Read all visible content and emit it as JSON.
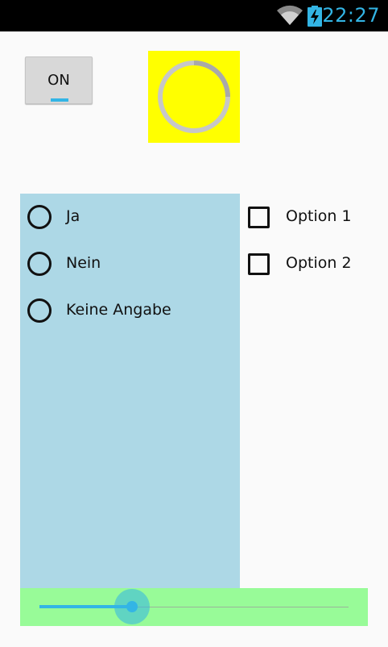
{
  "status_bar": {
    "time": "22:27",
    "wifi_icon": "wifi-icon",
    "battery_icon": "battery-charging-icon",
    "accent_color": "#33b5e5"
  },
  "toggle": {
    "label": "ON",
    "state": "on"
  },
  "spinner": {
    "icon": "progress-spinner-icon",
    "background": "#ffff00"
  },
  "radio_group": {
    "background": "#add8e6",
    "options": [
      {
        "label": "Ja",
        "checked": false
      },
      {
        "label": "Nein",
        "checked": false
      },
      {
        "label": "Keine Angabe",
        "checked": false
      }
    ]
  },
  "checkboxes": [
    {
      "label": "Option 1",
      "checked": false
    },
    {
      "label": "Option 2",
      "checked": false
    }
  ],
  "seekbar": {
    "background": "#98fb98",
    "progress_fraction": 0.3
  }
}
